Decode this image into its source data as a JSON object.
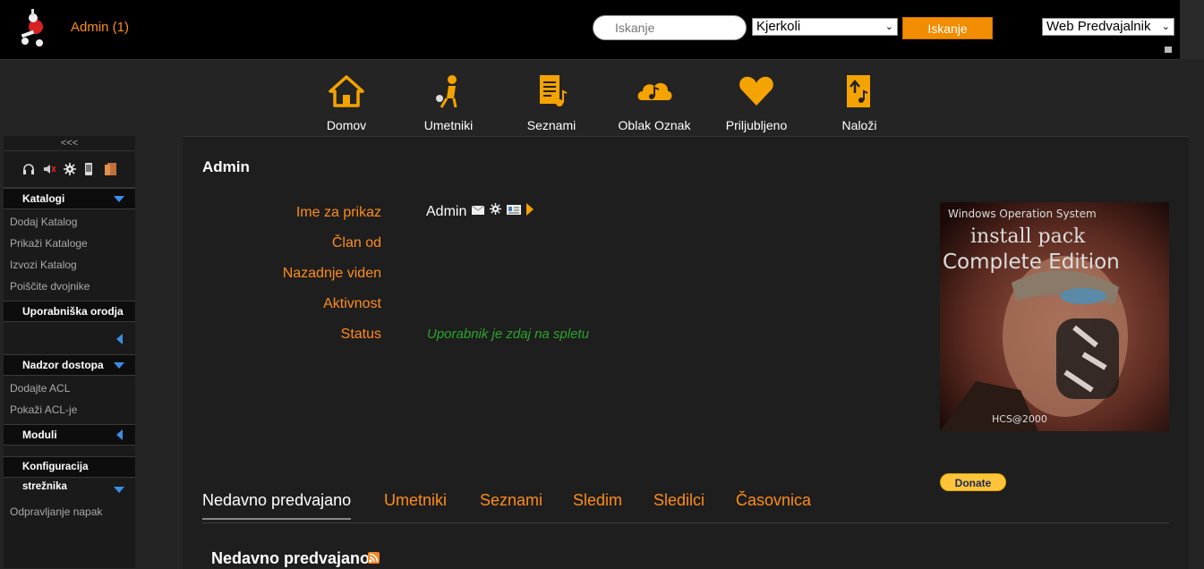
{
  "header": {
    "user_link": "Admin (1)",
    "search_placeholder": "Iskanje",
    "type_select": "Kjerkoli",
    "search_button": "Iskanje",
    "player_select": "Web Predvajalnik"
  },
  "nav": [
    {
      "label": "Domov",
      "icon": "home-icon"
    },
    {
      "label": "Umetniki",
      "icon": "artist-icon"
    },
    {
      "label": "Seznami",
      "icon": "playlist-icon"
    },
    {
      "label": "Oblak Oznak",
      "icon": "tag-cloud-icon"
    },
    {
      "label": "Priljubljeno",
      "icon": "heart-icon"
    },
    {
      "label": "Naloži",
      "icon": "upload-icon"
    }
  ],
  "sidebar": {
    "collapse_label": "<<<",
    "sections": [
      {
        "title": "Katalogi",
        "items": [
          "Dodaj Katalog",
          "Prikaži Kataloge",
          "Izvozi Katalog",
          "Poiščite dvojnike"
        ]
      },
      {
        "title": "Uporabniška orodja",
        "items": []
      },
      {
        "title": "Nadzor dostopa",
        "items": [
          "Dodajte ACL",
          "Pokaži ACL-je"
        ]
      },
      {
        "title": "Moduli",
        "items": []
      },
      {
        "title": "Konfiguracija strežnika",
        "items": [
          "Odpravljanje napak"
        ]
      }
    ]
  },
  "profile": {
    "title": "Admin",
    "labels": {
      "display_name": "Ime za prikaz",
      "member_since": "Član od",
      "last_seen": "Nazadnje viden",
      "activity": "Aktivnost",
      "status": "Status"
    },
    "display_name": "Admin",
    "status": "Uporabnik je zdaj na spletu",
    "avatar_text": [
      "Windows Operation System",
      "install pack",
      "Complete Edition",
      "HCS@2000"
    ],
    "donate": "Donate"
  },
  "tabs": [
    "Nedavno predvajano",
    "Umetniki",
    "Seznami",
    "Sledim",
    "Sledilci",
    "Časovnica"
  ],
  "section_title": "Nedavno predvajano",
  "colors": {
    "accent": "#ff8c1a",
    "status_green": "#2aa52a",
    "button_orange": "#f28c00",
    "arrow_blue": "#3a8ee6"
  }
}
